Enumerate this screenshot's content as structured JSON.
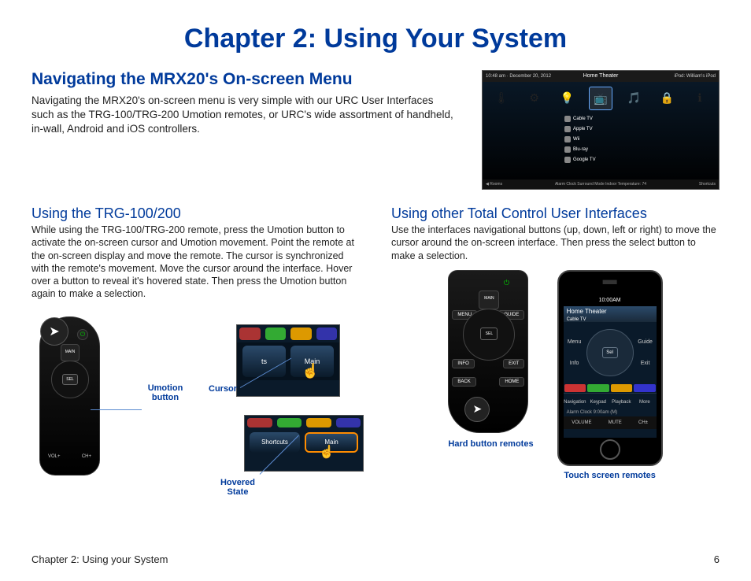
{
  "chapter_title": "Chapter 2: Using Your System",
  "section_heading": "Navigating the MRX20's On-screen Menu",
  "intro_text": "Navigating the MRX20's on-screen menu is very simple with our URC User Interfaces such as the TRG-100/TRG-200 Umotion remotes, or URC's wide assortment of handheld, in-wall, Android and iOS controllers.",
  "tv": {
    "clock": "10:48 am · December 20, 2012",
    "title": "Home Theater",
    "nowplaying": "iPod: William's iPod",
    "icons": [
      "Comfort",
      "Settings",
      "Lights",
      "Entertainment",
      "Music",
      "Security",
      "Info"
    ],
    "list": [
      "Cable TV",
      "Apple TV",
      "Wii",
      "Blu-ray",
      "Google TV"
    ],
    "bot_left": "◀ Rooms",
    "bot_mid": "Alarm Clock   Surround Mode   Indoor Temperature: 74",
    "bot_right": "Shortcuts"
  },
  "left": {
    "heading": "Using the TRG-100/200",
    "body": "While using the TRG-100/TRG-200 remote, press the Umotion button to activate the on-screen cursor and Umotion movement.  Point the remote at the on-screen display and move the remote.  The cursor is synchronized with the remote's movement.  Move the cursor around the interface. Hover over a button to reveal it's hovered state.  Then press the Umotion button again to make a selection.",
    "label_umotion": "Umotion button",
    "label_cursor": "Cursor",
    "label_hovered": "Hovered State",
    "remote": {
      "main": "MAIN",
      "sel": "SEL",
      "vol": "VOL+",
      "ch": "CH+"
    },
    "cursor_tabs": [
      "ts",
      "Main"
    ],
    "hover_tabs": [
      "Shortcuts",
      "Main"
    ]
  },
  "right": {
    "heading": "Using other Total Control User Interfaces",
    "body": "Use the interfaces navigational buttons (up, down, left or right) to move the cursor around the on-screen interface.  Then press the select button to make a selection.",
    "caption_hard": "Hard button remotes",
    "caption_touch": "Touch screen remotes",
    "remote": {
      "main": "MAIN",
      "menu": "MENU",
      "guide": "GUIDE",
      "sel": "SEL",
      "info": "INFO",
      "exit": "EXIT",
      "back": "BACK",
      "home": "HOME"
    },
    "phone": {
      "time": "10:00AM",
      "title": "Home Theater",
      "sub": "Cable TV",
      "menu": "Menu",
      "guide": "Guide",
      "info": "Info",
      "exit": "Exit",
      "sel": "Sel",
      "bot": [
        "Navigation",
        "Keypad",
        "Playback",
        "More"
      ],
      "alarm": "Alarm Clock 9:00am (M)",
      "vol": [
        "VOLUME",
        "MUTE",
        "CH±"
      ]
    }
  },
  "footer_left": "Chapter 2: Using your System",
  "footer_right": "6"
}
